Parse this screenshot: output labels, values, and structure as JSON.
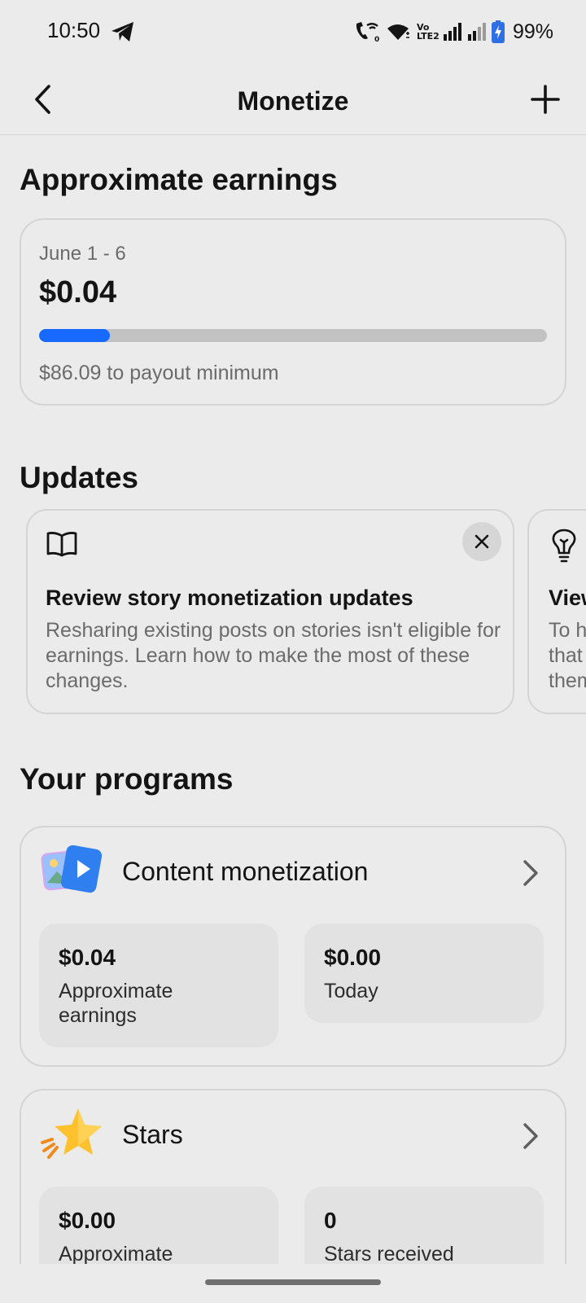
{
  "status_bar": {
    "time": "10:50",
    "volte_label": "Vo LTE2",
    "battery": "99%",
    "icons": [
      "telegram-icon",
      "wifi-calling-icon",
      "wifi-icon",
      "volte-icon",
      "signal-icon",
      "signal-weak-icon",
      "battery-icon"
    ]
  },
  "header": {
    "title": "Monetize",
    "back_icon": "chevron-left-icon",
    "add_icon": "plus-icon"
  },
  "earnings": {
    "section_title": "Approximate earnings",
    "period": "June 1 - 6",
    "amount": "$0.04",
    "progress_percent": 14,
    "progress_color": "#1769ff",
    "payout_note": "$86.09 to payout minimum"
  },
  "updates": {
    "section_title": "Updates",
    "cards": [
      {
        "icon": "book-icon",
        "title": "Review story monetization updates",
        "body": "Resharing existing posts on stories isn't eligible for earnings. Learn how to make the most of these changes.",
        "close_icon": "close-icon"
      },
      {
        "icon": "lightbulb-icon",
        "title": "View",
        "body": "To h\nthat\nthem"
      }
    ]
  },
  "programs": {
    "section_title": "Your programs",
    "items": [
      {
        "name": "Content monetization",
        "icon": "content-monetization-icon",
        "stats": [
          {
            "value": "$0.04",
            "label": "Approximate earnings"
          },
          {
            "value": "$0.00",
            "label": "Today"
          }
        ]
      },
      {
        "name": "Stars",
        "icon": "star-icon",
        "stats": [
          {
            "value": "$0.00",
            "label": "Approximate"
          },
          {
            "value": "0",
            "label": "Stars received"
          }
        ]
      }
    ]
  }
}
